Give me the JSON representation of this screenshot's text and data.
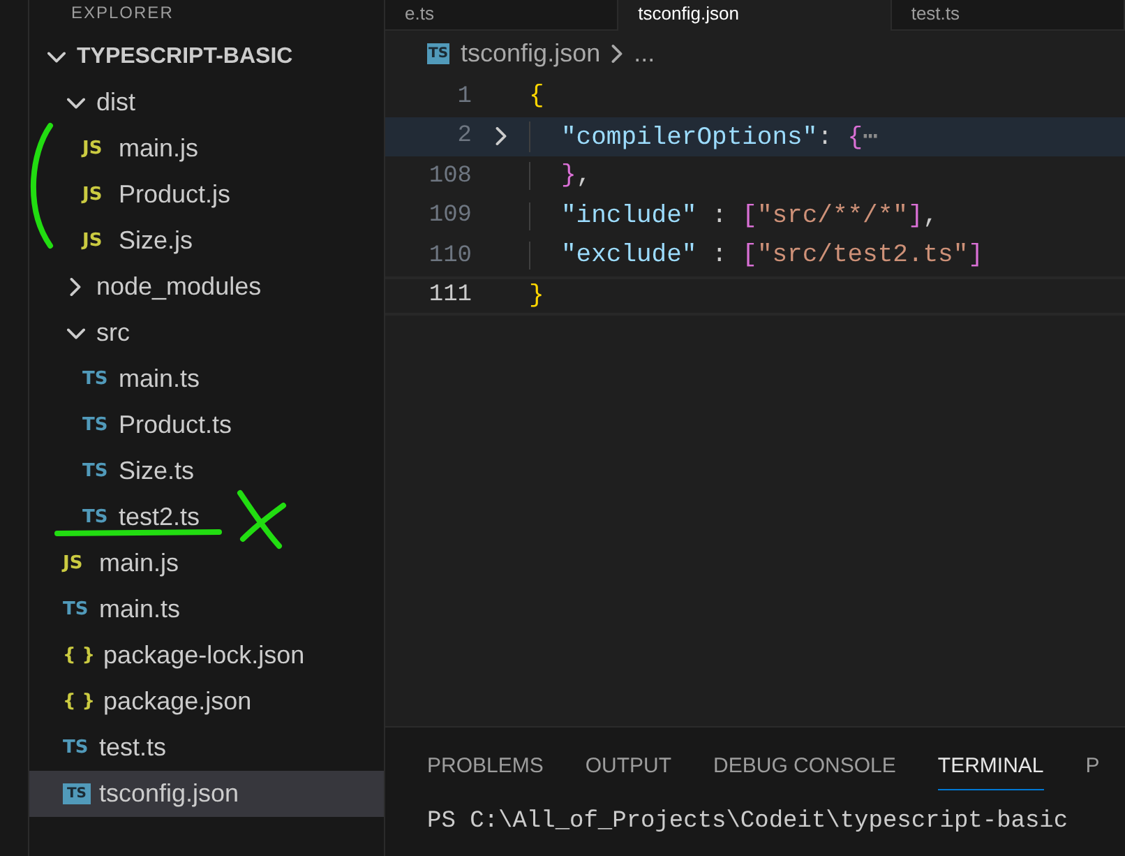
{
  "sidebar": {
    "title": "EXPLORER",
    "tree": [
      {
        "kind": "folder",
        "name": "TYPESCRIPT-BASIC",
        "root": true,
        "expanded": true,
        "children": [
          {
            "kind": "folder",
            "name": "dist",
            "expanded": true,
            "children": [
              {
                "kind": "js",
                "badge": "JS",
                "name": "main.js",
                "selected": false
              },
              {
                "kind": "js",
                "badge": "JS",
                "name": "Product.js",
                "selected": false
              },
              {
                "kind": "js",
                "badge": "JS",
                "name": "Size.js",
                "selected": false
              }
            ]
          },
          {
            "kind": "folder",
            "name": "node_modules",
            "expanded": false
          },
          {
            "kind": "folder",
            "name": "src",
            "expanded": true,
            "children": [
              {
                "kind": "ts",
                "badge": "TS",
                "name": "main.ts",
                "selected": false
              },
              {
                "kind": "ts",
                "badge": "TS",
                "name": "Product.ts",
                "selected": false
              },
              {
                "kind": "ts",
                "badge": "TS",
                "name": "Size.ts",
                "selected": false
              },
              {
                "kind": "ts",
                "badge": "TS",
                "name": "test2.ts",
                "selected": false
              }
            ]
          },
          {
            "kind": "js",
            "badge": "JS",
            "name": "main.js",
            "selected": false
          },
          {
            "kind": "ts",
            "badge": "TS",
            "name": "main.ts",
            "selected": false
          },
          {
            "kind": "json",
            "badge": "{ }",
            "name": "package-lock.json",
            "selected": false
          },
          {
            "kind": "json",
            "badge": "{ }",
            "name": "package.json",
            "selected": false
          },
          {
            "kind": "ts",
            "badge": "TS",
            "name": "test.ts",
            "selected": false
          },
          {
            "kind": "tsconfig",
            "badge": "TS",
            "name": "tsconfig.json",
            "selected": true
          }
        ]
      }
    ]
  },
  "editor": {
    "tabs": [
      {
        "label": "e.ts",
        "selected": false
      },
      {
        "label": "tsconfig.json",
        "selected": true
      },
      {
        "label": "test.ts",
        "selected": false
      }
    ],
    "breadcrumb": {
      "badge": "TS",
      "file": "tsconfig.json",
      "rest": "..."
    },
    "lines": [
      {
        "number": "1",
        "indented": false,
        "folded": false,
        "current": false,
        "tokens": [
          {
            "kind": "brace1",
            "text": "{"
          }
        ]
      },
      {
        "number": "2",
        "indented": true,
        "folded": true,
        "current": false,
        "tokens": [
          {
            "kind": "key",
            "text": "\"compilerOptions\""
          },
          {
            "kind": "punct",
            "text": ": "
          },
          {
            "kind": "brace2",
            "text": "{"
          },
          {
            "kind": "fold",
            "text": "⋯"
          }
        ]
      },
      {
        "number": "108",
        "indented": true,
        "folded": false,
        "current": false,
        "tokens": [
          {
            "kind": "brace2",
            "text": "}"
          },
          {
            "kind": "punct",
            "text": ","
          }
        ]
      },
      {
        "number": "109",
        "indented": true,
        "folded": false,
        "current": false,
        "tokens": [
          {
            "kind": "key",
            "text": "\"include\""
          },
          {
            "kind": "punct",
            "text": " : "
          },
          {
            "kind": "brace2",
            "text": "["
          },
          {
            "kind": "string",
            "text": "\"src/**/*\""
          },
          {
            "kind": "brace2",
            "text": "]"
          },
          {
            "kind": "punct",
            "text": ","
          }
        ]
      },
      {
        "number": "110",
        "indented": true,
        "folded": false,
        "current": false,
        "tokens": [
          {
            "kind": "key",
            "text": "\"exclude\""
          },
          {
            "kind": "punct",
            "text": " : "
          },
          {
            "kind": "brace2",
            "text": "["
          },
          {
            "kind": "string",
            "text": "\"src/test2.ts\""
          },
          {
            "kind": "brace2",
            "text": "]"
          }
        ]
      },
      {
        "number": "111",
        "indented": false,
        "folded": false,
        "current": true,
        "tokens": [
          {
            "kind": "brace1",
            "text": "}"
          }
        ]
      }
    ]
  },
  "panel": {
    "tabs": [
      {
        "label": "PROBLEMS",
        "selected": false
      },
      {
        "label": "OUTPUT",
        "selected": false
      },
      {
        "label": "DEBUG CONSOLE",
        "selected": false
      },
      {
        "label": "TERMINAL",
        "selected": true
      },
      {
        "label": "P",
        "selected": false
      }
    ],
    "terminal_line": "PS C:\\All_of_Projects\\Codeit\\typescript-basic"
  }
}
